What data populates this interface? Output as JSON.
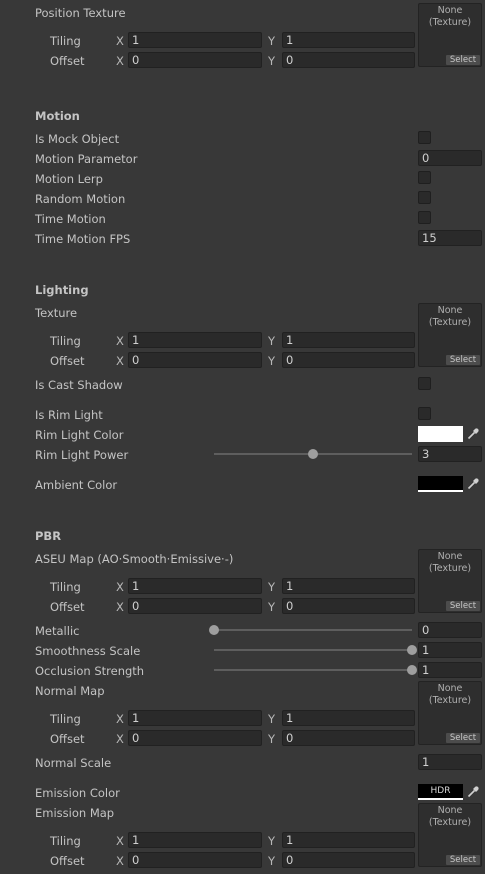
{
  "common": {
    "tiling": "Tiling",
    "offset": "Offset",
    "x": "X",
    "y": "Y",
    "tex_none": "None\n(Texture)",
    "tex_select": "Select"
  },
  "position": {
    "label": "Position Texture",
    "tiling_x": "1",
    "tiling_y": "1",
    "offset_x": "0",
    "offset_y": "0"
  },
  "motion": {
    "header": "Motion",
    "is_mock": "Is Mock Object",
    "param": "Motion Parametor",
    "param_value": "0",
    "lerp": "Motion Lerp",
    "random": "Random Motion",
    "time": "Time Motion",
    "fps": "Time Motion FPS",
    "fps_value": "15"
  },
  "lighting": {
    "header": "Lighting",
    "texture": "Texture",
    "tiling_x": "1",
    "tiling_y": "1",
    "offset_x": "0",
    "offset_y": "0",
    "cast_shadow": "Is Cast Shadow",
    "rim": "Is Rim Light",
    "rim_color": "Rim Light Color",
    "rim_color_hex": "#ffffff",
    "rim_power": "Rim Light Power",
    "rim_power_value": "3",
    "rim_power_fraction": 0.5,
    "ambient": "Ambient Color",
    "ambient_hex": "#000000"
  },
  "pbr": {
    "header": "PBR",
    "aseu": "ASEU Map (AO·Smooth·Emissive·-)",
    "aseu_tiling_x": "1",
    "aseu_tiling_y": "1",
    "aseu_offset_x": "0",
    "aseu_offset_y": "0",
    "metallic": "Metallic",
    "metallic_value": "0",
    "metallic_fraction": 0,
    "smoothness": "Smoothness Scale",
    "smoothness_value": "1",
    "smoothness_fraction": 1,
    "occlusion": "Occlusion Strength",
    "occlusion_value": "1",
    "occlusion_fraction": 1,
    "normal_map": "Normal Map",
    "nm_tiling_x": "1",
    "nm_tiling_y": "1",
    "nm_offset_x": "0",
    "nm_offset_y": "0",
    "normal_scale": "Normal Scale",
    "normal_scale_value": "1",
    "emission_color": "Emission Color",
    "hdr": "HDR",
    "emission_map": "Emission Map",
    "em_tiling_x": "1",
    "em_tiling_y": "1",
    "em_offset_x": "0",
    "em_offset_y": "0"
  }
}
